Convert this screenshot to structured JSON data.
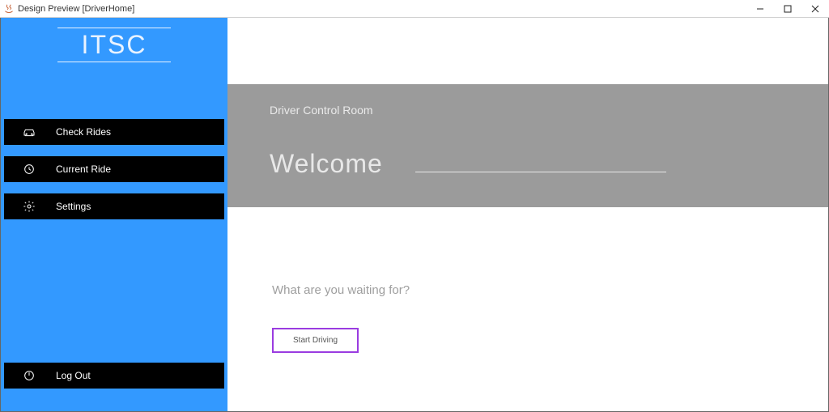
{
  "window": {
    "title": "Design Preview [DriverHome]"
  },
  "sidebar": {
    "brand": "ITSC",
    "items": [
      {
        "label": "Check Rides",
        "icon": "car-icon"
      },
      {
        "label": "Current Ride",
        "icon": "clock-icon"
      },
      {
        "label": "Settings",
        "icon": "gear-icon"
      }
    ],
    "logout": {
      "label": "Log Out",
      "icon": "power-icon"
    }
  },
  "main": {
    "header": {
      "title": "Driver Control Room",
      "welcome": "Welcome"
    },
    "cta": {
      "prompt": "What are you waiting for?",
      "button": "Start Driving"
    }
  }
}
